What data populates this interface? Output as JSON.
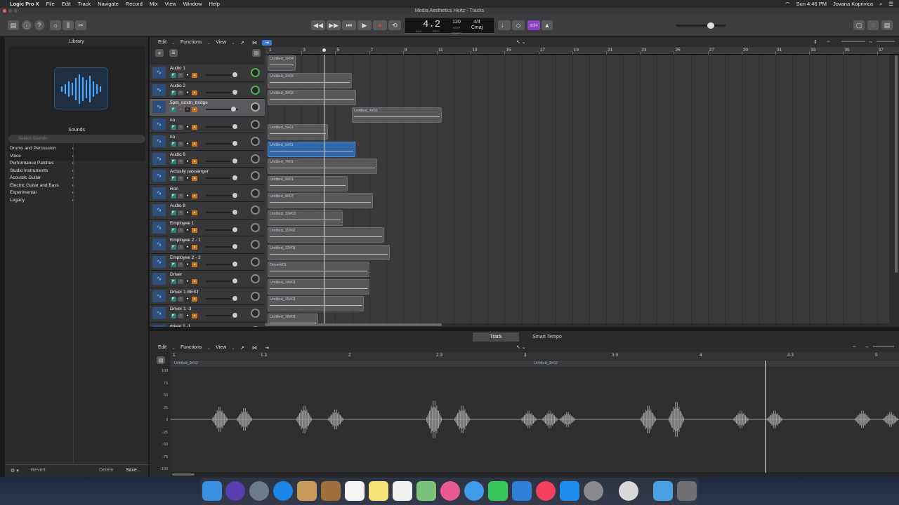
{
  "menubar": {
    "app": "Logic Pro X",
    "items": [
      "File",
      "Edit",
      "Track",
      "Navigate",
      "Record",
      "Mix",
      "View",
      "Window",
      "Help"
    ],
    "clock": "Sun 4:46 PM",
    "user": "Jovana Koprivica"
  },
  "window": {
    "title": "Media Aesthetics Hertz - Tracks"
  },
  "lcd": {
    "position": "4.2",
    "tempo": "120",
    "tempo_label": "KEEP",
    "signature": "4/4",
    "key": "Cmaj",
    "bar_label": "BAR",
    "beat_label": "BEAT",
    "tempo_sub": "TEMPO"
  },
  "toolbar": {
    "badge": "⊘34"
  },
  "library": {
    "title": "Library",
    "sounds_title": "Sounds",
    "search_placeholder": "Search Sounds",
    "categories": [
      "Drums and Percussion",
      "Voice",
      "Performance Patches",
      "Studio Instruments",
      "Acoustic Guitar",
      "Electric Guitar and Bass",
      "Experimental",
      "Legacy"
    ],
    "revert": "Revert",
    "delete": "Delete",
    "save": "Save..."
  },
  "tracks_menu": {
    "edit": "Edit",
    "functions": "Functions",
    "view": "View"
  },
  "ruler": {
    "bars": [
      "1",
      "3",
      "5",
      "7",
      "9",
      "11",
      "13",
      "15",
      "17",
      "19",
      "21",
      "23",
      "25",
      "27",
      "29",
      "31",
      "33",
      "35",
      "37"
    ]
  },
  "tracks": [
    {
      "name": "Audio 1",
      "region": "Untitled_1#04",
      "selected": false,
      "sel_region": false,
      "start": 0,
      "len": 40
    },
    {
      "name": "Audio 2",
      "region": "Untitled_2#02",
      "selected": false,
      "sel_region": false,
      "start": 0,
      "len": 120
    },
    {
      "name": "5pm_londn_bridge",
      "region": "Untitled_3#02",
      "selected": true,
      "sel_region": false,
      "start": 0,
      "len": 126
    },
    {
      "name": "no",
      "region": "Untitled_4#01",
      "selected": false,
      "sel_region": false,
      "start": 120,
      "len": 128
    },
    {
      "name": "no",
      "region": "Untitled_5#01",
      "selected": false,
      "sel_region": false,
      "start": 0,
      "len": 86
    },
    {
      "name": "Audio 6",
      "region": "Untitled_6#01",
      "selected": false,
      "sel_region": true,
      "start": 0,
      "len": 125
    },
    {
      "name": "Actually passanger",
      "region": "Untitled_7#01",
      "selected": false,
      "sel_region": false,
      "start": 0,
      "len": 156
    },
    {
      "name": "Ron",
      "region": "Untitled_9#01",
      "selected": false,
      "sel_region": false,
      "start": 0,
      "len": 114
    },
    {
      "name": "Audio 8",
      "region": "Untitled_8#07",
      "selected": false,
      "sel_region": false,
      "start": 0,
      "len": 150
    },
    {
      "name": "Employee 1",
      "region": "Untitled_10#03",
      "selected": false,
      "sel_region": false,
      "start": 0,
      "len": 107
    },
    {
      "name": "Employee 2 - 1",
      "region": "Untitled_11#02",
      "selected": false,
      "sel_region": false,
      "start": 0,
      "len": 166
    },
    {
      "name": "Employee 2 - 2",
      "region": "Untitled_12#01",
      "selected": false,
      "sel_region": false,
      "start": 0,
      "len": 174
    },
    {
      "name": "Driver",
      "region": "Driver#01",
      "selected": false,
      "sel_region": false,
      "start": 0,
      "len": 145
    },
    {
      "name": "Driver 1  BEST",
      "region": "Untitled_14#01",
      "selected": false,
      "sel_region": false,
      "start": 0,
      "len": 145
    },
    {
      "name": "Driver 1 -3",
      "region": "Untitled_15#01",
      "selected": false,
      "sel_region": false,
      "start": 0,
      "len": 137
    },
    {
      "name": "driver 2 -1",
      "region": "Untitled_16#01",
      "selected": false,
      "sel_region": false,
      "start": 0,
      "len": 72
    }
  ],
  "editor": {
    "tabs": [
      "Track",
      "Smart Tempo"
    ],
    "ruler": [
      "1",
      "1.3",
      "2",
      "2.3",
      "3",
      "3.3",
      "4",
      "4.3",
      "5"
    ],
    "regions": [
      "Untitled_3#02",
      "Untitled_3#02"
    ],
    "y_axis": [
      "100",
      "75",
      "50",
      "25",
      "0",
      "-25",
      "-50",
      "-75",
      "-100"
    ]
  }
}
